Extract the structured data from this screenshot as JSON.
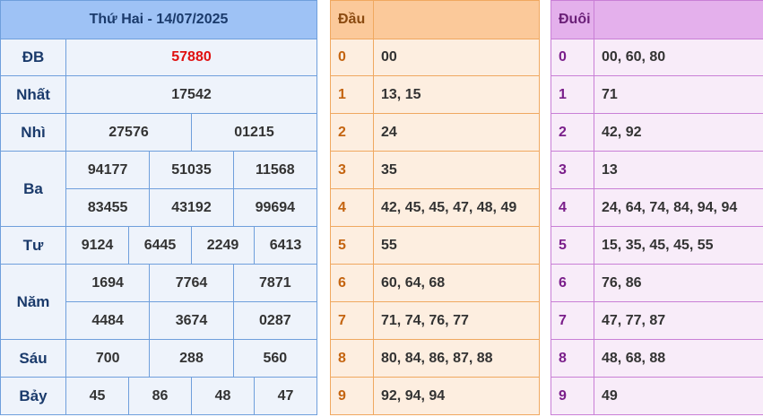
{
  "results": {
    "header": "Thứ Hai - 14/07/2025",
    "rows": [
      {
        "label": "ĐB",
        "lines": [
          [
            "57880"
          ]
        ]
      },
      {
        "label": "Nhất",
        "lines": [
          [
            "17542"
          ]
        ]
      },
      {
        "label": "Nhì",
        "lines": [
          [
            "27576",
            "01215"
          ]
        ]
      },
      {
        "label": "Ba",
        "lines": [
          [
            "94177",
            "51035",
            "11568"
          ],
          [
            "83455",
            "43192",
            "99694"
          ]
        ]
      },
      {
        "label": "Tư",
        "lines": [
          [
            "9124",
            "6445",
            "2249",
            "6413"
          ]
        ]
      },
      {
        "label": "Năm",
        "lines": [
          [
            "1694",
            "7764",
            "7871"
          ],
          [
            "4484",
            "3674",
            "0287"
          ]
        ]
      },
      {
        "label": "Sáu",
        "lines": [
          [
            "700",
            "288",
            "560"
          ]
        ]
      },
      {
        "label": "Bảy",
        "lines": [
          [
            "45",
            "86",
            "48",
            "47"
          ]
        ]
      }
    ],
    "special_color": "#e01010"
  },
  "dau": {
    "header": "Đầu",
    "rows": [
      {
        "k": "0",
        "v": "00"
      },
      {
        "k": "1",
        "v": "13, 15"
      },
      {
        "k": "2",
        "v": "24"
      },
      {
        "k": "3",
        "v": "35"
      },
      {
        "k": "4",
        "v": "42, 45, 45, 47, 48, 49"
      },
      {
        "k": "5",
        "v": "55"
      },
      {
        "k": "6",
        "v": "60, 64, 68"
      },
      {
        "k": "7",
        "v": "71, 74, 76, 77"
      },
      {
        "k": "8",
        "v": "80, 84, 86, 87, 88"
      },
      {
        "k": "9",
        "v": "92, 94, 94"
      }
    ]
  },
  "duoi": {
    "header": "Đuôi",
    "rows": [
      {
        "k": "0",
        "v": "00, 60, 80"
      },
      {
        "k": "1",
        "v": "71"
      },
      {
        "k": "2",
        "v": "42, 92"
      },
      {
        "k": "3",
        "v": "13"
      },
      {
        "k": "4",
        "v": "24, 64, 74, 84, 94, 94"
      },
      {
        "k": "5",
        "v": "15, 35, 45, 45, 55"
      },
      {
        "k": "6",
        "v": "76, 86"
      },
      {
        "k": "7",
        "v": "47, 77, 87"
      },
      {
        "k": "8",
        "v": "48, 68, 88"
      },
      {
        "k": "9",
        "v": "49"
      }
    ]
  }
}
